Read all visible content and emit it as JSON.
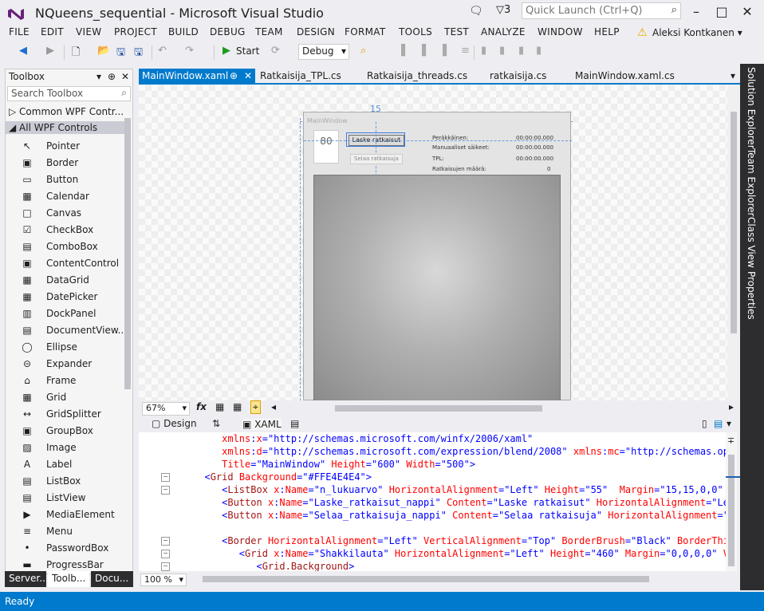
{
  "window": {
    "title": "NQueens_sequential - Microsoft Visual Studio",
    "notification_count": "3",
    "quick_launch_placeholder": "Quick Launch (Ctrl+Q)",
    "user": "Aleksi Kontkanen"
  },
  "menu": [
    "FILE",
    "EDIT",
    "VIEW",
    "PROJECT",
    "BUILD",
    "DEBUG",
    "TEAM",
    "DESIGN",
    "FORMAT",
    "TOOLS",
    "TEST",
    "ANALYZE",
    "WINDOW",
    "HELP"
  ],
  "toolbar": {
    "start_label": "Start",
    "config": "Debug"
  },
  "toolbox": {
    "title": "Toolbox",
    "search_placeholder": "Search Toolbox",
    "categories": [
      "Common WPF Contr...",
      "All WPF Controls"
    ],
    "items": [
      "Pointer",
      "Border",
      "Button",
      "Calendar",
      "Canvas",
      "CheckBox",
      "ComboBox",
      "ContentControl",
      "DataGrid",
      "DatePicker",
      "DockPanel",
      "DocumentView...",
      "Ellipse",
      "Expander",
      "Frame",
      "Grid",
      "GridSplitter",
      "GroupBox",
      "Image",
      "Label",
      "ListBox",
      "ListView",
      "MediaElement",
      "Menu",
      "PasswordBox",
      "ProgressBar"
    ]
  },
  "bottom_tabs": [
    "Server...",
    "Toolb...",
    "Docu..."
  ],
  "doc_tabs": [
    "MainWindow.xaml",
    "Ratkaisija_TPL.cs",
    "Ratkaisija_threads.cs",
    "ratkaisija.cs",
    "MainWindow.xaml.cs"
  ],
  "designer": {
    "window_title": "MainWindow",
    "listbox_value": "80",
    "margin_label": "15",
    "laske_button": "Laske ratkaisut",
    "selaa_button": "Selaa ratkaisuja",
    "info_labels": [
      "Peräkkäinen:",
      "Manuaaliset säikeet:",
      "TPL:",
      "Ratkaisujen määrä:"
    ],
    "info_values": [
      "00:00:00.000",
      "00:00:00.000",
      "00:00:00.000",
      "0"
    ]
  },
  "zoom": {
    "designer": "67%",
    "code": "100 %"
  },
  "split_tabs": {
    "design": "Design",
    "xaml": "XAML"
  },
  "code_lines": [
    {
      "indent": "     ",
      "segs": [
        [
          "a",
          "xmlns"
        ],
        [
          "v",
          ":"
        ],
        [
          "a",
          "x"
        ],
        [
          "v",
          "=\"http://schemas.microsoft.com/winfx/2006/xaml\""
        ]
      ]
    },
    {
      "indent": "     ",
      "segs": [
        [
          "a",
          "xmlns"
        ],
        [
          "v",
          ":"
        ],
        [
          "a",
          "d"
        ],
        [
          "v",
          "=\"http://schemas.microsoft.com/expression/blend/2008\" "
        ],
        [
          "a",
          "xmlns"
        ],
        [
          "v",
          ":"
        ],
        [
          "a",
          "mc"
        ],
        [
          "v",
          "=\"http://schemas.openxm"
        ]
      ]
    },
    {
      "indent": "     ",
      "segs": [
        [
          "a",
          "Title"
        ],
        [
          "v",
          "=\"MainWindow\" "
        ],
        [
          "a",
          "Height"
        ],
        [
          "v",
          "=\"600\" "
        ],
        [
          "a",
          "Width"
        ],
        [
          "v",
          "=\"500\">"
        ]
      ]
    },
    {
      "indent": "  ",
      "segs": [
        [
          "v",
          "<"
        ],
        [
          "k",
          "Grid"
        ],
        [
          "a",
          " Background"
        ],
        [
          "v",
          "=\"#FFE4E4E4\">"
        ]
      ]
    },
    {
      "indent": "     ",
      "segs": [
        [
          "v",
          "<"
        ],
        [
          "k",
          "ListBox"
        ],
        [
          "a",
          " x"
        ],
        [
          "v",
          ":"
        ],
        [
          "a",
          "Name"
        ],
        [
          "v",
          "=\"n_lukuarvo\" "
        ],
        [
          "a",
          "HorizontalAlignment"
        ],
        [
          "v",
          "=\"Left\" "
        ],
        [
          "a",
          "Height"
        ],
        [
          "v",
          "=\"55\"  "
        ],
        [
          "a",
          "Margin"
        ],
        [
          "v",
          "=\"15,15,0,0\" "
        ],
        [
          "a",
          "Ver"
        ]
      ]
    },
    {
      "indent": "     ",
      "segs": [
        [
          "v",
          "<"
        ],
        [
          "k",
          "Button"
        ],
        [
          "a",
          " x"
        ],
        [
          "v",
          ":"
        ],
        [
          "a",
          "Name"
        ],
        [
          "v",
          "=\"Laske_ratkaisut_nappi\" "
        ],
        [
          "a",
          "Content"
        ],
        [
          "v",
          "=\"Laske ratkaisut\" "
        ],
        [
          "a",
          "HorizontalAlignment"
        ],
        [
          "v",
          "=\"Left\" "
        ]
      ]
    },
    {
      "indent": "     ",
      "segs": [
        [
          "v",
          "<"
        ],
        [
          "k",
          "Button"
        ],
        [
          "a",
          " x"
        ],
        [
          "v",
          ":"
        ],
        [
          "a",
          "Name"
        ],
        [
          "v",
          "=\"Selaa_ratkaisuja_nappi\" "
        ],
        [
          "a",
          "Content"
        ],
        [
          "v",
          "=\"Selaa ratkaisuja\" "
        ],
        [
          "a",
          "HorizontalAlignment"
        ],
        [
          "v",
          "=\"Lef"
        ]
      ]
    },
    {
      "indent": "",
      "segs": []
    },
    {
      "indent": "     ",
      "segs": [
        [
          "v",
          "<"
        ],
        [
          "k",
          "Border"
        ],
        [
          "a",
          " HorizontalAlignment"
        ],
        [
          "v",
          "=\"Left\" "
        ],
        [
          "a",
          "VerticalAlignment"
        ],
        [
          "v",
          "=\"Top\" "
        ],
        [
          "a",
          "BorderBrush"
        ],
        [
          "v",
          "=\"Black\" "
        ],
        [
          "a",
          "BorderThickne"
        ]
      ]
    },
    {
      "indent": "        ",
      "segs": [
        [
          "v",
          "<"
        ],
        [
          "k",
          "Grid"
        ],
        [
          "a",
          " x"
        ],
        [
          "v",
          ":"
        ],
        [
          "a",
          "Name"
        ],
        [
          "v",
          "=\"Shakkilauta\" "
        ],
        [
          "a",
          "HorizontalAlignment"
        ],
        [
          "v",
          "=\"Left\" "
        ],
        [
          "a",
          "Height"
        ],
        [
          "v",
          "=\"460\" "
        ],
        [
          "a",
          "Margin"
        ],
        [
          "v",
          "=\"0,0,0,0\" "
        ],
        [
          "a",
          "Ver"
        ]
      ]
    },
    {
      "indent": "           ",
      "segs": [
        [
          "v",
          "<"
        ],
        [
          "k",
          "Grid.Background"
        ],
        [
          "v",
          ">"
        ]
      ]
    }
  ],
  "right_tabs": [
    "Solution Explorer",
    "Team Explorer",
    "Class View",
    "Properties"
  ],
  "status": "Ready",
  "colors": {
    "accent": "#007acc",
    "chrome": "#eeeef2",
    "dark": "#2d2d30"
  },
  "icons": {
    "logo": "vs-logo-icon",
    "search": "search-icon",
    "start": "play-icon"
  }
}
